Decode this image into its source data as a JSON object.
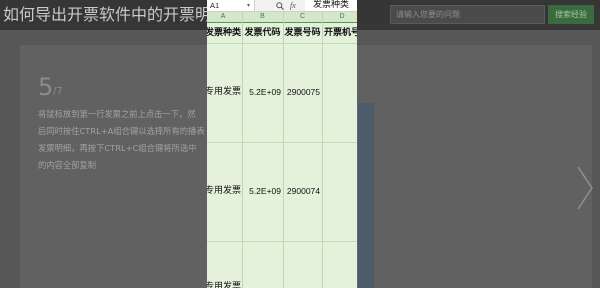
{
  "header": {
    "title": "如何导出开票软件中的开票明细",
    "search": {
      "placeholder": "请输入您要的问题",
      "button_label": "搜索经验"
    }
  },
  "step": {
    "number": "5",
    "total": "/7",
    "text_lines": [
      "将鼠标放到第一行发票之前上点击一下，然",
      "后同时按住CTRL+A组合键以选择所有的播表",
      "发票明细，再按下CTRL+C组合键将所选中",
      "的内容全部复制"
    ]
  },
  "spreadsheet": {
    "name_box": "A1",
    "function_label": "fx",
    "formula_content": "发票种类",
    "column_letters": [
      "A",
      "B",
      "C",
      "D"
    ],
    "headers": [
      "发票种类",
      "发票代码",
      "发票号码",
      "开票机号"
    ],
    "rows": [
      {
        "type": "专用发票",
        "code": "5.2E+09",
        "number": "2900075"
      },
      {
        "type": "专用发票",
        "code": "5.2E+09",
        "number": "2900074"
      },
      {
        "type": "专用发票"
      }
    ]
  },
  "icons": {
    "next": "chevron-right-icon",
    "zoom": "zoom-icon",
    "name_box_dropdown": "dropdown-arrow-icon"
  },
  "colors": {
    "selection_fill": "#e4f1db",
    "column_header_accent": "#45a04f",
    "search_button": "#3b6a3e"
  }
}
